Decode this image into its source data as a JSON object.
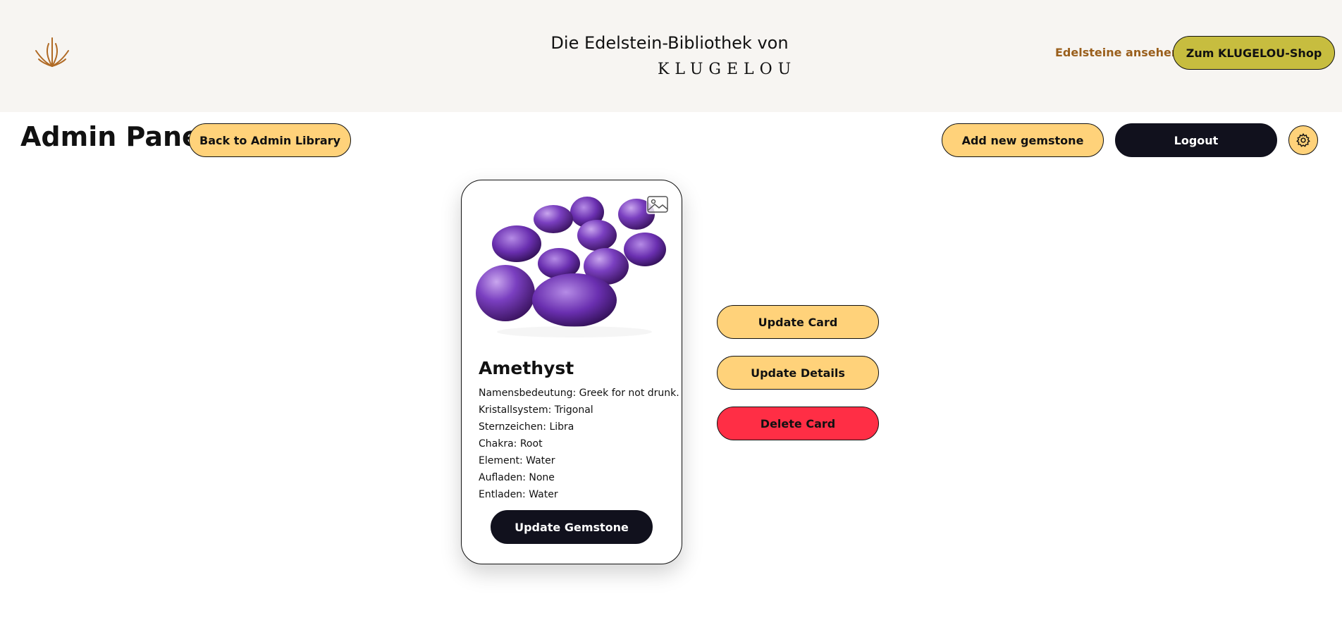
{
  "header": {
    "title": "Die Edelstein-Bibliothek von",
    "brand": "KLUGELOU",
    "nav_link": "Edelsteine ansehen",
    "shop_button": "Zum KLUGELOU-Shop",
    "logo_icon": "lotus-logo-icon"
  },
  "toolbar": {
    "page_title": "Admin Panel",
    "back_button": "Back to Admin Library",
    "add_button": "Add new gemstone",
    "logout_button": "Logout",
    "settings_icon": "gear-icon"
  },
  "card": {
    "title": "Amethyst",
    "image_icon": "image-icon",
    "attributes": [
      "Namensbedeutung: Greek for not drunk.",
      "Kristallsystem: Trigonal",
      "Sternzeichen: Libra",
      "Chakra: Root",
      "Element: Water",
      "Aufladen: None",
      "Entladen: Water"
    ],
    "update_button": "Update Gemstone"
  },
  "actions": {
    "update_card": "Update Card",
    "update_details": "Update Details",
    "delete_card": "Delete Card"
  },
  "colors": {
    "header_bg": "#f7f5f2",
    "accent_yellow": "#ffd27a",
    "shop_olive": "#c7bd3f",
    "dark": "#11111d",
    "delete_red": "#ff2e45",
    "nav_link_brown": "#9a5f1c"
  }
}
